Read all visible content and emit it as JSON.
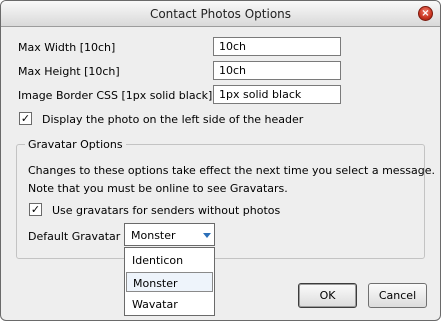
{
  "window": {
    "title": "Contact Photos Options",
    "close_glyph": "×"
  },
  "fields": {
    "max_width": {
      "label": "Max Width [10ch]",
      "value": "10ch"
    },
    "max_height": {
      "label": "Max Height [10ch]",
      "value": "10ch"
    },
    "border_css": {
      "label": "Image Border CSS [1px solid black]",
      "value": "1px solid black"
    }
  },
  "display_left": {
    "label": "Display the photo on the left side of the header",
    "checked": true,
    "mark": "✓"
  },
  "gravatar": {
    "group_title": "Gravatar Options",
    "note_line1": "Changes to these options take effect the next time you select a message.",
    "note_line2": "Note that you must be online to see Gravatars.",
    "use_gravatars": {
      "label": "Use gravatars for senders without photos",
      "checked": true,
      "mark": "✓"
    },
    "default_label": "Default Gravatar",
    "selected": "Monster",
    "options": [
      "Identicon",
      "Monster",
      "Wavatar"
    ]
  },
  "buttons": {
    "ok": "OK",
    "cancel": "Cancel"
  }
}
